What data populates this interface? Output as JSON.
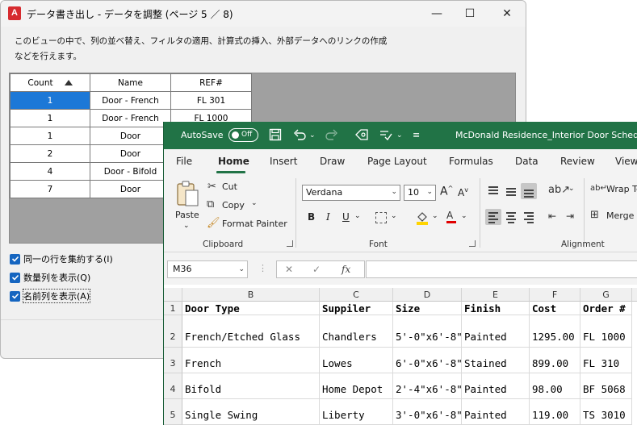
{
  "dialog": {
    "title": "データ書き出し - データを調整 (ページ 5 ／ 8)",
    "app_icon_letter": "A",
    "minimize": "—",
    "maximize": "☐",
    "close": "✕",
    "description_line1": "このビューの中で、列の並べ替え、フィルタの適用、計算式の挿入、外部データへのリンクの作成",
    "description_line2": "などを行えます。",
    "grid": {
      "headers": [
        "Count",
        "Name",
        "REF#"
      ],
      "rows": [
        [
          "1",
          "Door - French",
          "FL 301"
        ],
        [
          "1",
          "Door - French",
          "FL 1000"
        ],
        [
          "1",
          "Door",
          ""
        ],
        [
          "2",
          "Door",
          ""
        ],
        [
          "4",
          "Door - Bifold",
          ""
        ],
        [
          "7",
          "Door",
          ""
        ]
      ]
    },
    "checkboxes": [
      {
        "label": "同一の行を集約する(I)",
        "checked": true
      },
      {
        "label": "数量列を表示(Q)",
        "checked": true
      },
      {
        "label": "名前列を表示(A)",
        "checked": true
      }
    ]
  },
  "excel": {
    "autosave_label": "AutoSave",
    "autosave_state": "Off",
    "doc_title": "McDonald Residence_Interior Door Schedu",
    "tabs": [
      "File",
      "Home",
      "Insert",
      "Draw",
      "Page Layout",
      "Formulas",
      "Data",
      "Review",
      "View"
    ],
    "active_tab": "Home",
    "clipboard": {
      "paste": "Paste",
      "cut": "Cut",
      "copy": "Copy",
      "format_painter": "Format Painter",
      "group_label": "Clipboard"
    },
    "font": {
      "name": "Verdana",
      "size": "10",
      "group_label": "Font"
    },
    "alignment": {
      "wrap_text": "Wrap Te",
      "merge": "Merge &",
      "group_label": "Alignment"
    },
    "name_box": "M36",
    "fx_label": "fx",
    "columns": [
      "B",
      "C",
      "D",
      "E",
      "F",
      "G"
    ],
    "rows": [
      {
        "num": "1",
        "cells": [
          "Door Type",
          "Suppiler",
          "Size",
          "Finish",
          "Cost",
          "Order #"
        ]
      },
      {
        "num": "2",
        "cells": [
          "French/Etched Glass",
          "Chandlers",
          "5'-0\"x6'-8\"",
          "Painted",
          "1295.00",
          "FL 1000"
        ]
      },
      {
        "num": "3",
        "cells": [
          "French",
          "Lowes",
          "6'-0\"x6'-8\"",
          "Stained",
          "899.00",
          "FL 310"
        ]
      },
      {
        "num": "4",
        "cells": [
          "Bifold",
          "Home Depot",
          "2'-4\"x6'-8\"",
          "Painted",
          "98.00",
          "BF 5068"
        ]
      },
      {
        "num": "5",
        "cells": [
          "Single Swing",
          "Liberty",
          "3'-0\"x6'-8\"",
          "Painted",
          "119.00",
          "TS 3010"
        ]
      }
    ]
  }
}
